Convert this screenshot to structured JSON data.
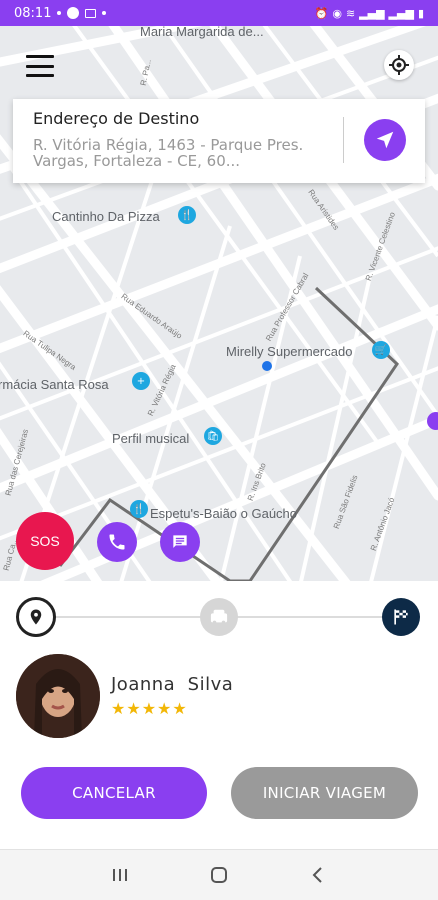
{
  "status_bar": {
    "time": "08:11"
  },
  "map": {
    "top_label": "Maria Margarida de...",
    "places": [
      {
        "name": "Cantinho Da Pizza"
      },
      {
        "name": "Mirelly Supermercado"
      },
      {
        "name": "rmácia Santa Rosa"
      },
      {
        "name": "Perfil musical"
      },
      {
        "name": "Espetu's-Baião o Gaúcho"
      }
    ],
    "streets": [
      "R. Pa...",
      "Rua Eduardo Araújo",
      "Rua Tulipa Negra",
      "R. Vitória Régia",
      "Rua Professor Cabral",
      "Rua Aristides",
      "R. Vicente Celestino",
      "R. Ins Brito",
      "Rua São Fidelis",
      "R. Antônio Jacó",
      "Rua das Cerejeiras",
      "Rua Ca..."
    ]
  },
  "destination": {
    "title": "Endereço de Destino",
    "address": "R. Vitória Régia, 1463 - Parque Pres. Vargas, Fortaleza - CE, 60..."
  },
  "buttons": {
    "sos": "SOS",
    "cancel": "CANCELAR",
    "start_trip": "INICIAR VIAGEM"
  },
  "driver": {
    "name": "Joanna  Silva",
    "stars": "★★★★★",
    "rating": 5
  },
  "icons": {
    "menu": "menu-icon",
    "locate": "gps-locate-icon",
    "navigate": "navigation-arrow-icon",
    "phone": "phone-icon",
    "chat": "chat-icon",
    "start": "location-pin-icon",
    "middle": "car-icon",
    "end": "checkered-flag-icon"
  },
  "colors": {
    "accent": "#8a3ff0",
    "sos": "#e8174f",
    "disabled": "#9a9a9a",
    "star": "#f2b707",
    "map_poi": "#1ea7e0",
    "route": "#6f6f6f"
  }
}
